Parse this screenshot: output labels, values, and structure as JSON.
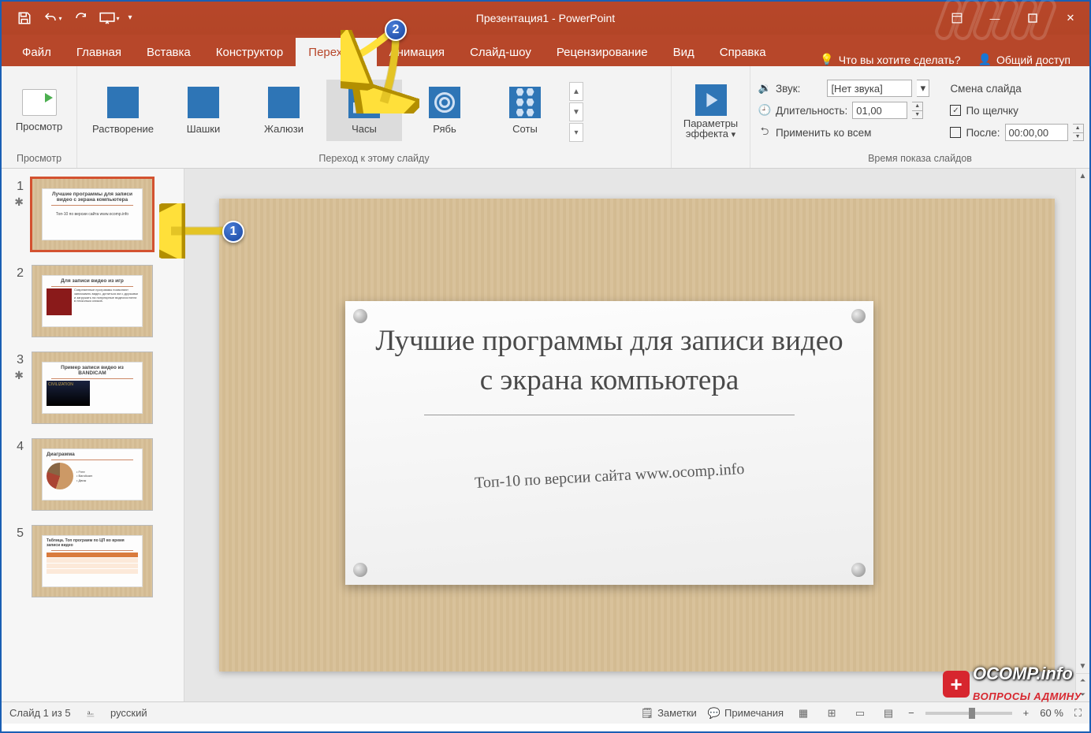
{
  "title": "Презентация1 - PowerPoint",
  "qat": {
    "save": "save-icon",
    "undo": "undo-icon",
    "redo": "redo-icon",
    "start": "start-from-beginning-icon"
  },
  "tabs": [
    "Файл",
    "Главная",
    "Вставка",
    "Конструктор",
    "Переходы",
    "Анимация",
    "Слайд-шоу",
    "Рецензирование",
    "Вид",
    "Справка"
  ],
  "active_tab_index": 4,
  "tell_me": "Что вы хотите сделать?",
  "share": "Общий доступ",
  "ribbon": {
    "preview_group": {
      "label": "Просмотр",
      "btn": "Просмотр"
    },
    "gallery": {
      "label": "Переход к этому слайду",
      "items": [
        "Растворение",
        "Шашки",
        "Жалюзи",
        "Часы",
        "Рябь",
        "Соты"
      ],
      "selected_index": 3
    },
    "effect_options": {
      "label1": "Параметры",
      "label2": "эффекта"
    },
    "timing": {
      "group_label": "Время показа слайдов",
      "sound_label": "Звук:",
      "sound_value": "[Нет звука]",
      "duration_label": "Длительность:",
      "duration_value": "01,00",
      "apply_all": "Применить ко всем",
      "advance_header": "Смена слайда",
      "on_click_checked": true,
      "on_click_label": "По щелчку",
      "after_checked": false,
      "after_label": "После:",
      "after_value": "00:00,00"
    }
  },
  "thumbs": [
    {
      "n": "1",
      "star": true,
      "title": "Лучшие программы для записи видео с экрана компьютера",
      "sub": "Топ-10 по версии сайта www.ocomp.info"
    },
    {
      "n": "2",
      "star": false,
      "title": "Для записи видео из игр",
      "sub": ""
    },
    {
      "n": "3",
      "star": true,
      "title": "Пример записи видео из BANDICAM",
      "sub": ""
    },
    {
      "n": "4",
      "star": false,
      "title": "Диаграмма",
      "sub": ""
    },
    {
      "n": "5",
      "star": false,
      "title": "Таблица. Топ программ по ЦП во время записи видео",
      "sub": ""
    }
  ],
  "slide": {
    "heading": "Лучшие программы для записи видео с экрана компьютера",
    "subtitle": "Топ-10 по версии сайта www.ocomp.info"
  },
  "status": {
    "slide_info": "Слайд 1 из 5",
    "lang": "русский",
    "notes": "Заметки",
    "comments": "Примечания",
    "zoom": "60 %"
  },
  "watermark": {
    "brand": "OCOMP",
    "tld": ".info",
    "tagline": "ВОПРОСЫ АДМИНУ"
  },
  "annotations": {
    "b1": "1",
    "b2": "2"
  }
}
